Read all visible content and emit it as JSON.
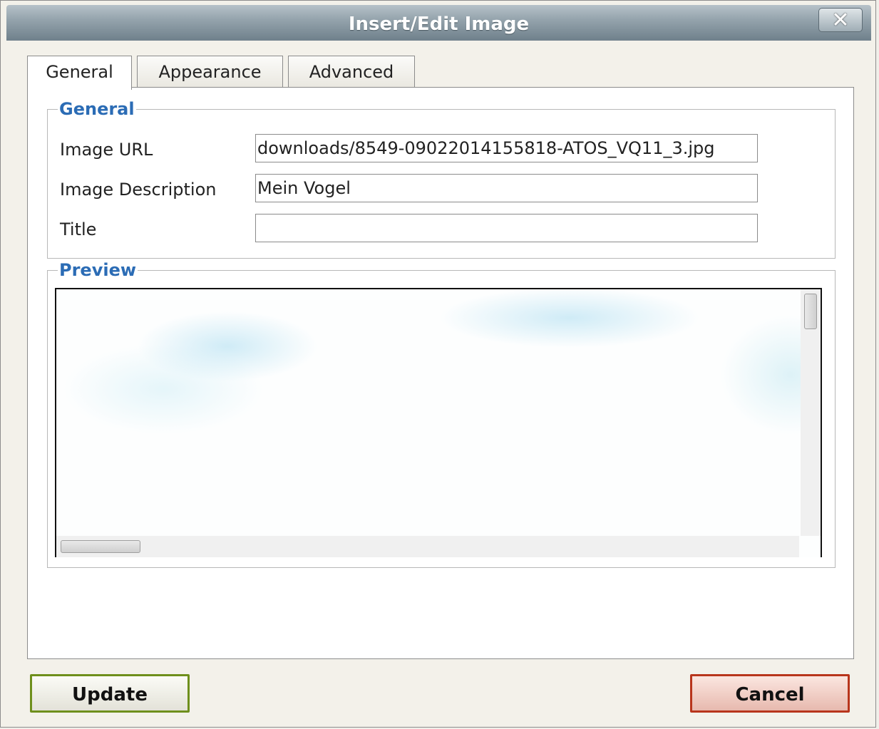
{
  "window": {
    "title": "Insert/Edit Image",
    "close_label": "✕"
  },
  "tabs": [
    {
      "label": "General",
      "active": true
    },
    {
      "label": "Appearance",
      "active": false
    },
    {
      "label": "Advanced",
      "active": false
    }
  ],
  "general_group": {
    "legend": "General",
    "fields": {
      "image_url": {
        "label": "Image URL",
        "value": "downloads/8549-09022014155818-ATOS_VQ11_3.jpg"
      },
      "image_description": {
        "label": "Image Description",
        "value": "Mein Vogel"
      },
      "title": {
        "label": "Title",
        "value": ""
      }
    }
  },
  "preview_group": {
    "legend": "Preview"
  },
  "buttons": {
    "update": "Update",
    "cancel": "Cancel"
  },
  "colors": {
    "legend": "#2b6cb5",
    "update_border": "#6e8f1c",
    "cancel_border": "#b8351c"
  }
}
